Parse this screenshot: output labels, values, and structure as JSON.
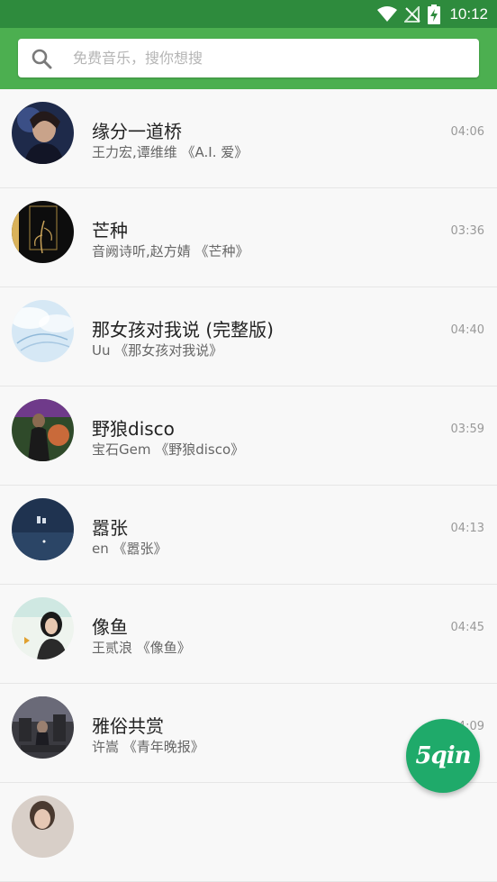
{
  "status_bar": {
    "time": "10:12",
    "icons": [
      "wifi-icon",
      "signal-off-icon",
      "battery-charging-icon"
    ]
  },
  "search": {
    "placeholder": "免费音乐，搜你想搜",
    "icon": "search-icon"
  },
  "songs": [
    {
      "title": "缘分一道桥",
      "subtitle": "王力宏,谭维维 《A.I. 爱》",
      "duration": "04:06"
    },
    {
      "title": "芒种",
      "subtitle": "音阙诗听,赵方婧 《芒种》",
      "duration": "03:36"
    },
    {
      "title": "那女孩对我说 (完整版)",
      "subtitle": "Uu 《那女孩对我说》",
      "duration": "04:40"
    },
    {
      "title": "野狼disco",
      "subtitle": "宝石Gem 《野狼disco》",
      "duration": "03:59"
    },
    {
      "title": "嚣张",
      "subtitle": "en 《嚣张》",
      "duration": "04:13"
    },
    {
      "title": "像鱼",
      "subtitle": "王贰浪 《像鱼》",
      "duration": "04:45"
    },
    {
      "title": "雅俗共赏",
      "subtitle": "许嵩 《青年晚报》",
      "duration": "04:09"
    },
    {
      "title": "",
      "subtitle": "",
      "duration": ""
    }
  ],
  "fab": {
    "label": "5qin"
  },
  "colors": {
    "status_bar": "#2e8b3d",
    "app_bar": "#4caf50",
    "fab": "#1faa6a"
  }
}
